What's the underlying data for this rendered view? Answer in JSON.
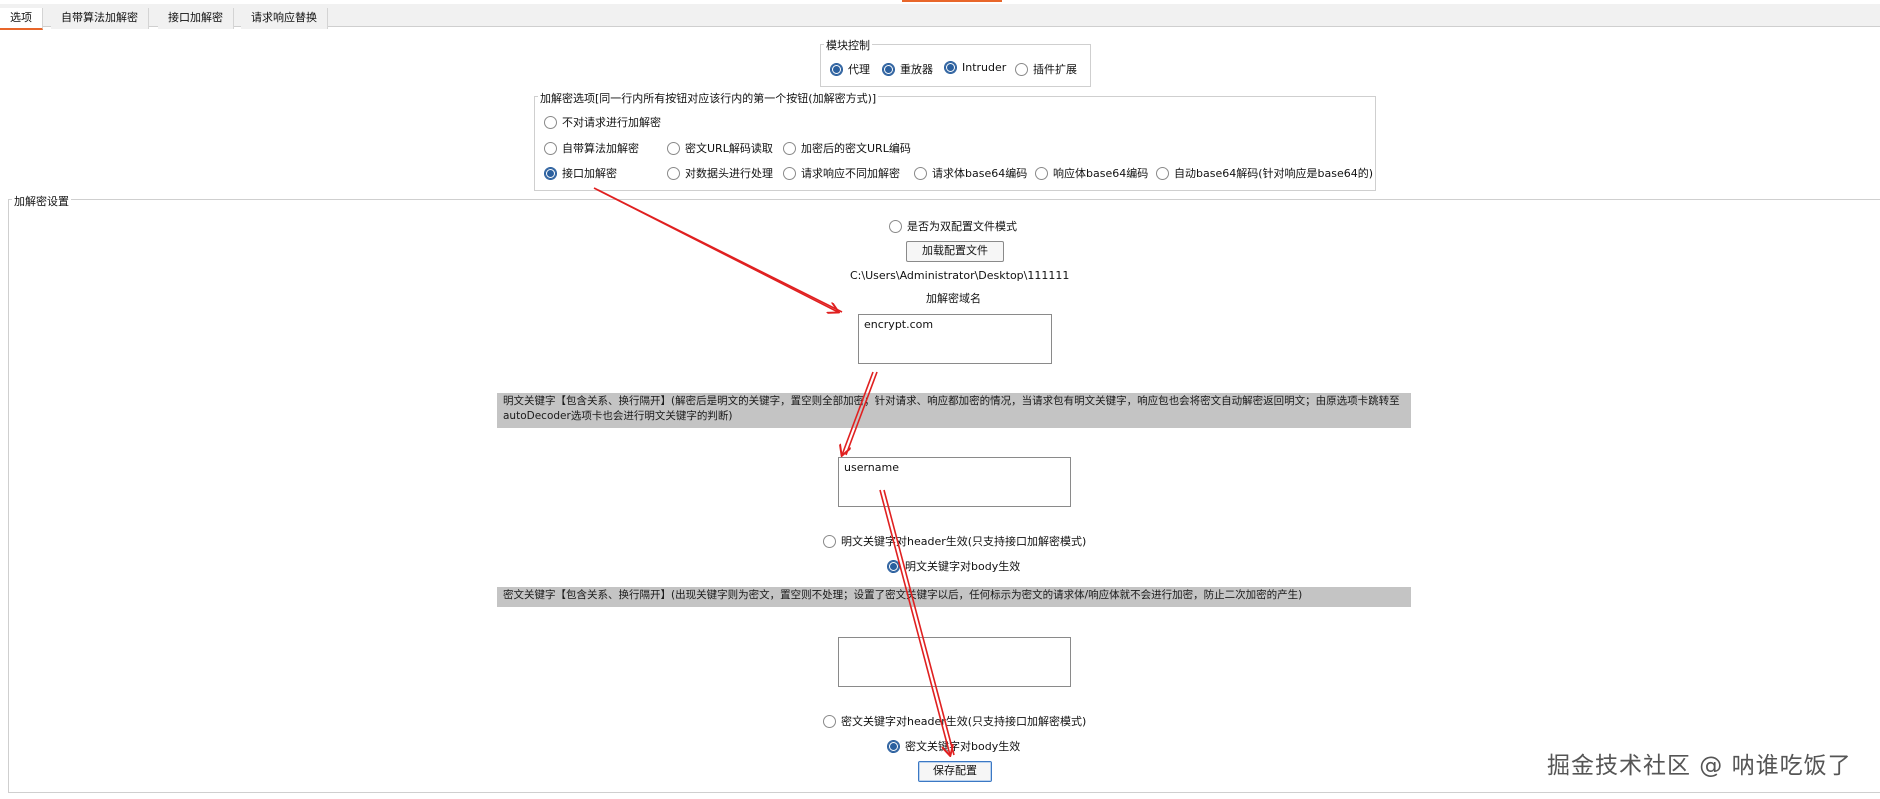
{
  "tabs": [
    "选项",
    "自带算法加解密",
    "接口加解密",
    "请求响应替换"
  ],
  "module_control": {
    "legend": "模块控制",
    "options": [
      {
        "label": "代理",
        "checked": true
      },
      {
        "label": "重放器",
        "checked": true
      },
      {
        "label": "Intruder",
        "checked": true
      },
      {
        "label": "插件扩展",
        "checked": false
      }
    ]
  },
  "crypto_options": {
    "legend": "加解密选项[同一行内所有按钮对应该行内的第一个按钮(加解密方式)]",
    "row1": [
      {
        "label": "不对请求进行加解密",
        "checked": false
      }
    ],
    "row2": [
      {
        "label": "自带算法加解密",
        "checked": false
      },
      {
        "label": "密文URL解码读取",
        "checked": false
      },
      {
        "label": "加密后的密文URL编码",
        "checked": false
      }
    ],
    "row3": [
      {
        "label": "接口加解密",
        "checked": true
      },
      {
        "label": "对数据头进行处理",
        "checked": false
      },
      {
        "label": "请求响应不同加解密",
        "checked": false
      },
      {
        "label": "请求体base64编码",
        "checked": false
      },
      {
        "label": "响应体base64编码",
        "checked": false
      },
      {
        "label": "自动base64解码(针对响应是base64的)",
        "checked": false
      }
    ]
  },
  "settings": {
    "legend": "加解密设置",
    "dual_config_label": "是否为双配置文件模式",
    "load_config_button": "加载配置文件",
    "config_path": "C:\\Users\\Administrator\\Desktop\\111111",
    "domain_label": "加解密域名",
    "domain_value": "encrypt.com",
    "plain_keyword_note": "明文关键字【包含关系、换行隔开】(解密后是明文的关键字，置空则全部加密；针对请求、响应都加密的情况，当请求包有明文关键字，响应包也会将密文自动解密返回明文；由原选项卡跳转至autoDecoder选项卡也会进行明文关键字的判断)",
    "plain_keyword_value": "username",
    "plain_header_label": "明文关键字对header生效(只支持接口加解密模式)",
    "plain_body_label": "明文关键字对body生效",
    "cipher_keyword_note": "密文关键字【包含关系、换行隔开】(出现关键字则为密文，置空则不处理；设置了密文关键字以后，任何标示为密文的请求体/响应体就不会进行加密，防止二次加密的产生)",
    "cipher_keyword_value": "",
    "cipher_header_label": "密文关键字对header生效(只支持接口加解密模式)",
    "cipher_body_label": "密文关键字对body生效",
    "save_button": "保存配置"
  },
  "watermark": "掘金技术社区 @ 呐谁吃饭了",
  "colors": {
    "accent": "#e8662a",
    "radio_selected": "#2a5f9e",
    "arrow": "#e02020",
    "note_bg": "#c4c4c4"
  }
}
